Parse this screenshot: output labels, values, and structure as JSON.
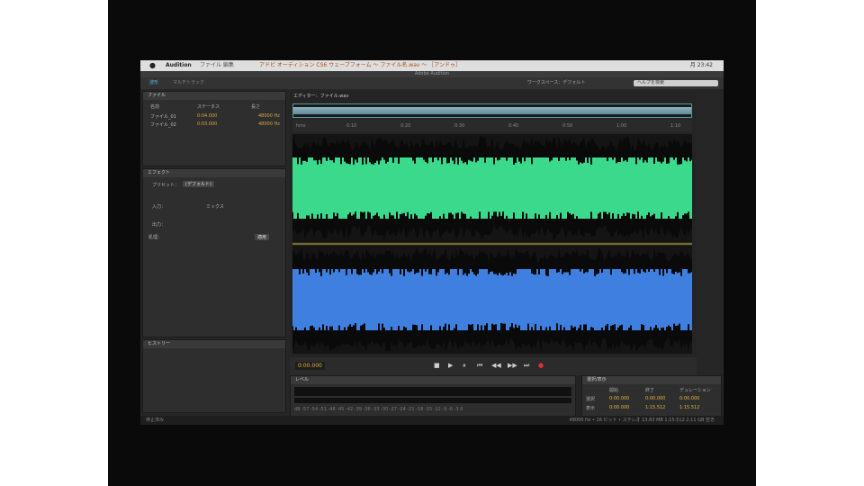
{
  "menubar": {
    "app_name": "Audition",
    "menus": "ファイル 編集",
    "window_title": "アドビ オーディション CS6 ウェーブフォーム ～ ファイル名.wav ～ ［アンドゥ］",
    "status": "月 23:42"
  },
  "window": {
    "title": "Adobe Audition"
  },
  "toolbar": {
    "waveform_label": "波形",
    "multitrack_label": "マルチトラック",
    "workspace_label": "ワークスペース：デフォルト",
    "search_placeholder": "ヘルプを検索"
  },
  "files_panel": {
    "title": "ファイル",
    "columns": [
      "名前",
      "ステータス",
      "長さ"
    ],
    "files": [
      {
        "name": "ファイル_01",
        "duration": "0:04.000",
        "rate": "48000 Hz"
      },
      {
        "name": "ファイル_02",
        "duration": "0:03.000",
        "rate": "48000 Hz"
      }
    ]
  },
  "effects_panel": {
    "title": "エフェクト",
    "preset_label": "プリセット：",
    "preset_value": "(デフォルト)",
    "input_label": "入力：",
    "output_label": "出力：",
    "mix_label": "ミックス",
    "process_label": "処理：",
    "apply_label": "適用"
  },
  "history_panel": {
    "title": "ヒストリー"
  },
  "editor": {
    "tab_label": "エディター：ファイル.wav",
    "ruler_labels": [
      "hms",
      "0:10",
      "0:20",
      "0:30",
      "0:40",
      "0:50",
      "1:00",
      "1:10"
    ],
    "channel_colors": {
      "left": "#3ad98c",
      "right": "#3f7fe0"
    }
  },
  "transport": {
    "timecode": "0:00.000",
    "buttons": [
      "■",
      "▶",
      "⏸",
      "⏮",
      "◀◀",
      "▶▶",
      "⏭",
      "●"
    ]
  },
  "levels_panel": {
    "title": "レベル",
    "scale": [
      "dB",
      "-57",
      "-54",
      "-51",
      "-48",
      "-45",
      "-42",
      "-39",
      "-36",
      "-33",
      "-30",
      "-27",
      "-24",
      "-21",
      "-18",
      "-15",
      "-12",
      "-9",
      "-6",
      "-3",
      "0"
    ]
  },
  "selection_panel": {
    "title": "選択/表示",
    "headers": [
      "開始",
      "終了",
      "デュレーション"
    ],
    "rows": [
      {
        "label": "選択",
        "start": "0:00.000",
        "end": "0:00.000",
        "duration": "0:00.000"
      },
      {
        "label": "表示",
        "start": "0:00.000",
        "end": "1:15.512",
        "duration": "1:15.512"
      }
    ]
  },
  "statusbar": {
    "left": "停止済み",
    "right": "48000 Hz • 16 ビット • ステレオ  13.83 MB  1:15.512  2.11 GB 空き"
  }
}
